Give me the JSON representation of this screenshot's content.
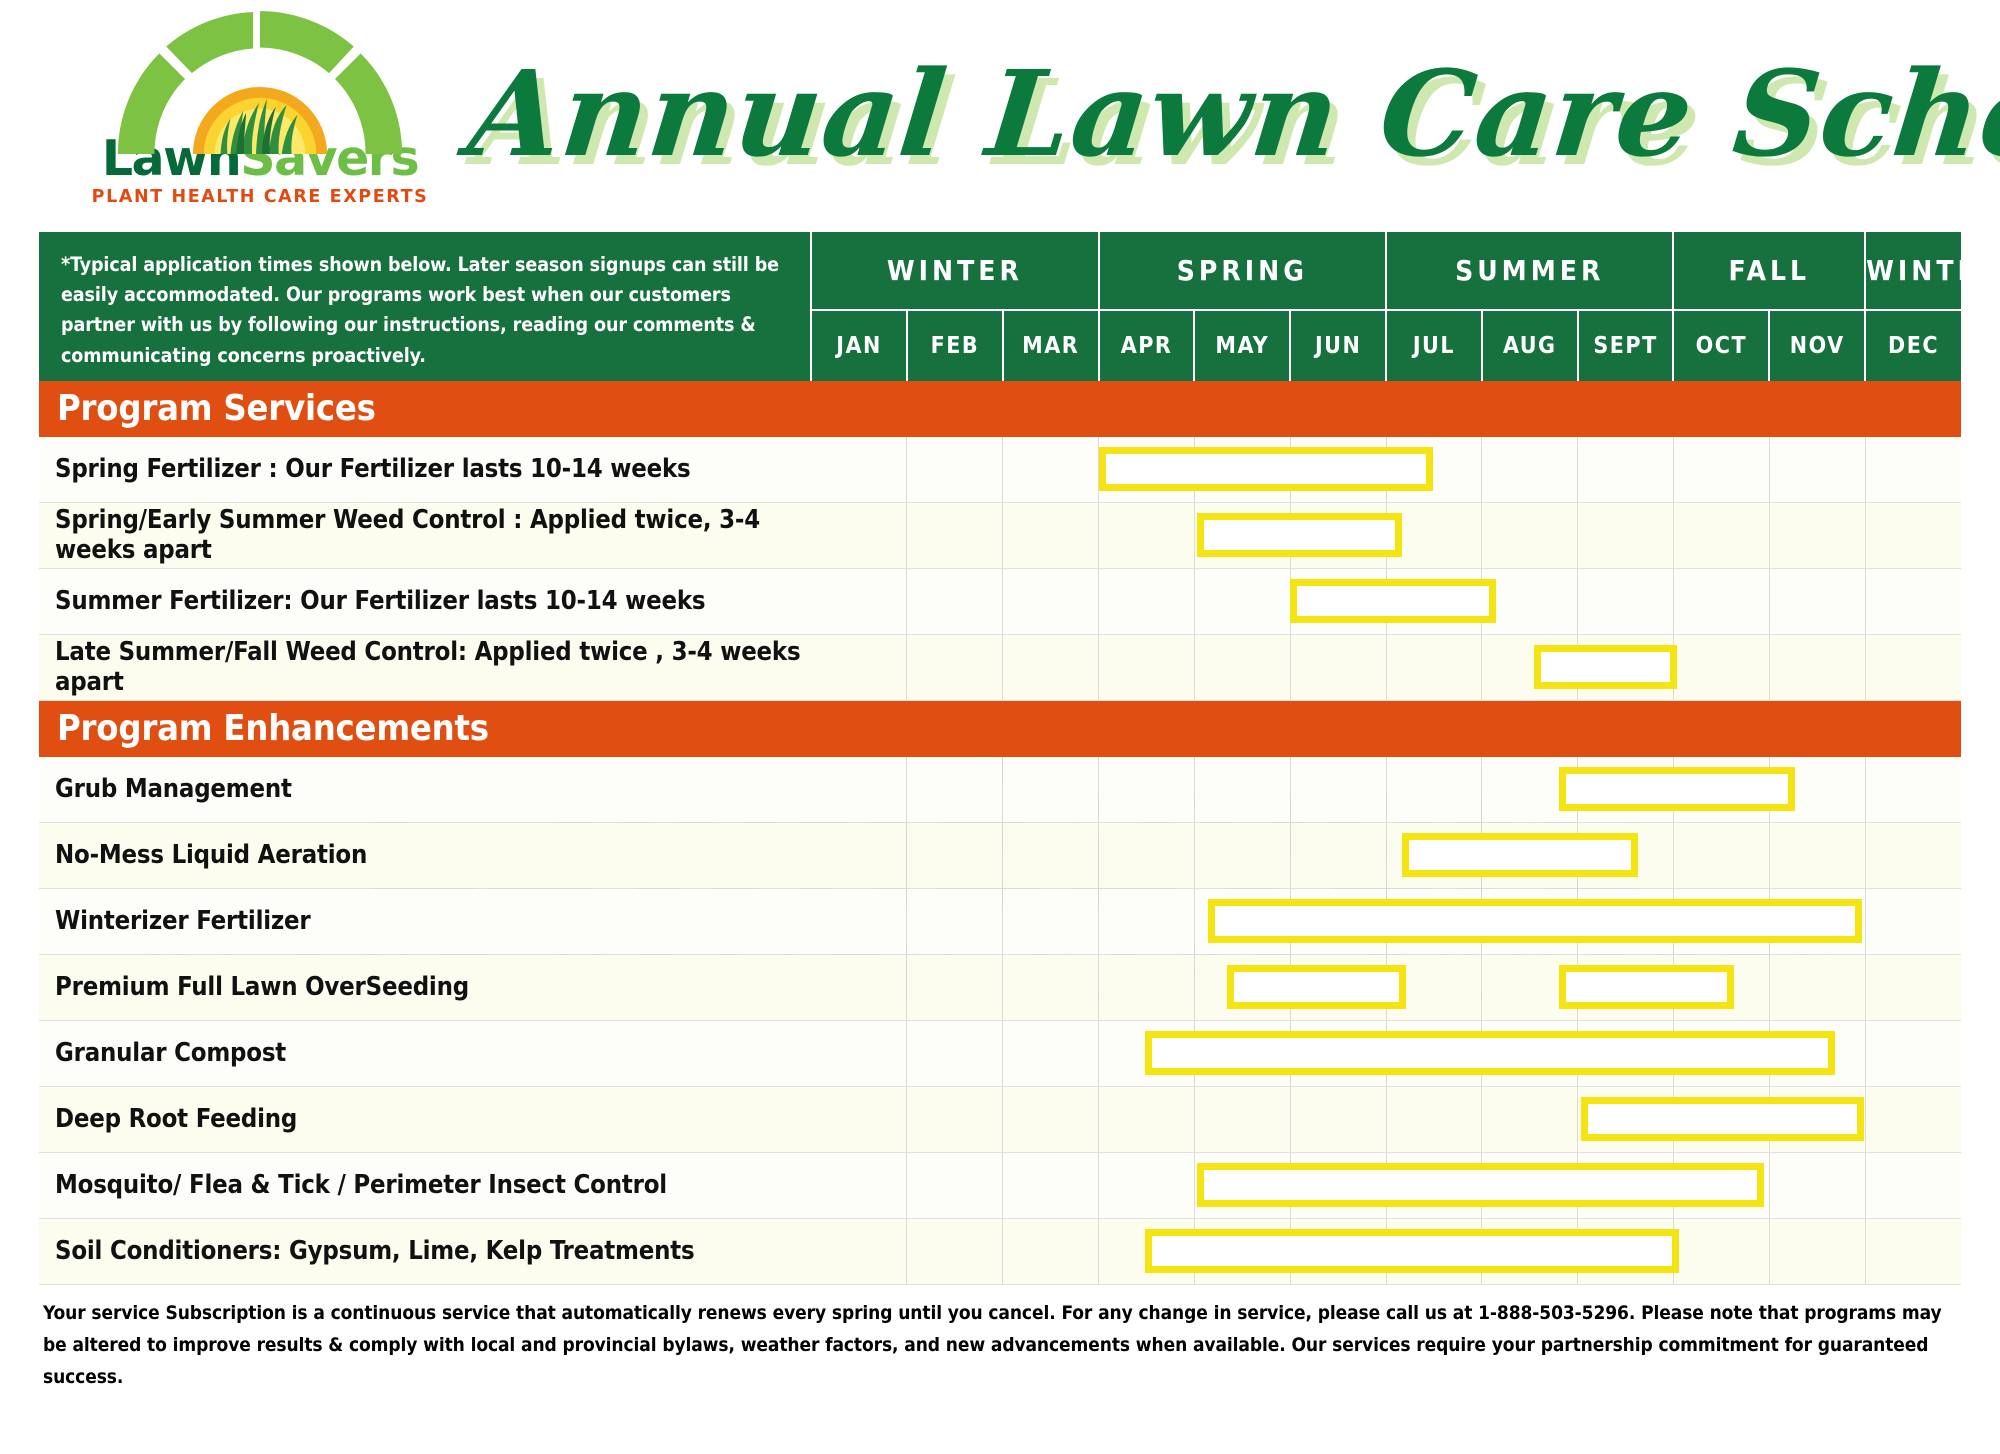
{
  "brand": {
    "logo_word_part1": "Lawn",
    "logo_word_part2": "Savers",
    "tagline": "PLANT HEALTH CARE EXPERTS",
    "colors": {
      "dark_green": "#05693a",
      "light_green": "#6cbe45",
      "orange": "#e14a10",
      "header_green": "#17713f",
      "section_orange": "#e04e12",
      "bar_yellow": "#f5e411"
    }
  },
  "title": "Annual Lawn Care Schedule",
  "note": "*Typical application times shown below. Later season signups can still be easily accommodated. Our programs work best when our customers partner with us by following our instructions, reading our comments & communicating concerns proactively.",
  "watermark": {
    "line1": "LawnSavers",
    "line2": "PLANT HEALTH CARE EXPERTS"
  },
  "seasons": [
    {
      "label": "WINTER",
      "span": 3
    },
    {
      "label": "SPRING",
      "span": 3
    },
    {
      "label": "SUMMER",
      "span": 3
    },
    {
      "label": "FALL",
      "span": 2
    },
    {
      "label": "WINTER",
      "span": 1
    }
  ],
  "months": [
    "JAN",
    "FEB",
    "MAR",
    "APR",
    "MAY",
    "JUN",
    "JUL",
    "AUG",
    "SEPT",
    "OCT",
    "NOV",
    "DEC"
  ],
  "sections": [
    {
      "heading": "Program Services",
      "rows": [
        {
          "label": "Spring Fertilizer : Our Fertilizer lasts 10-14 weeks",
          "bars": [
            [
              3.02,
              6.52
            ]
          ]
        },
        {
          "label": "Spring/Early Summer Weed Control : Applied twice,  3-4 weeks apart",
          "bars": [
            [
              4.05,
              6.2
            ]
          ]
        },
        {
          "label": "Summer Fertilizer: Our Fertilizer lasts 10-14 weeks",
          "bars": [
            [
              5.02,
              7.18
            ]
          ]
        },
        {
          "label": "Late Summer/Fall Weed Control: Applied twice , 3-4 weeks apart",
          "bars": [
            [
              7.58,
              9.08
            ]
          ]
        }
      ]
    },
    {
      "heading": "Program Enhancements",
      "rows": [
        {
          "label": "Grub Management",
          "bars": [
            [
              7.85,
              10.32
            ]
          ]
        },
        {
          "label": "No-Mess Liquid Aeration",
          "bars": [
            [
              6.2,
              8.68
            ]
          ]
        },
        {
          "label": "Winterizer Fertilizer",
          "bars": [
            [
              4.16,
              11.02
            ]
          ]
        },
        {
          "label": "Premium Full Lawn OverSeeding",
          "bars": [
            [
              4.36,
              6.24
            ],
            [
              7.85,
              9.68
            ]
          ]
        },
        {
          "label": "Granular Compost",
          "bars": [
            [
              3.5,
              10.74
            ]
          ]
        },
        {
          "label": "Deep Root Feeding",
          "bars": [
            [
              8.08,
              11.05
            ]
          ]
        },
        {
          "label": "Mosquito/ Flea &  Tick / Perimeter Insect Control",
          "bars": [
            [
              4.05,
              10.0
            ]
          ]
        },
        {
          "label": "Soil Conditioners: Gypsum, Lime, Kelp Treatments",
          "bars": [
            [
              3.5,
              9.1
            ]
          ]
        }
      ]
    }
  ],
  "footer": "Your service Subscription is a continuous service that automatically renews every spring until you cancel. For any change in service, please call us at 1-888-503-5296. Please note that programs may be altered to improve results & comply with local and provincial bylaws, weather factors, and new advancements when available. Our services require your partnership commitment for guaranteed success."
}
